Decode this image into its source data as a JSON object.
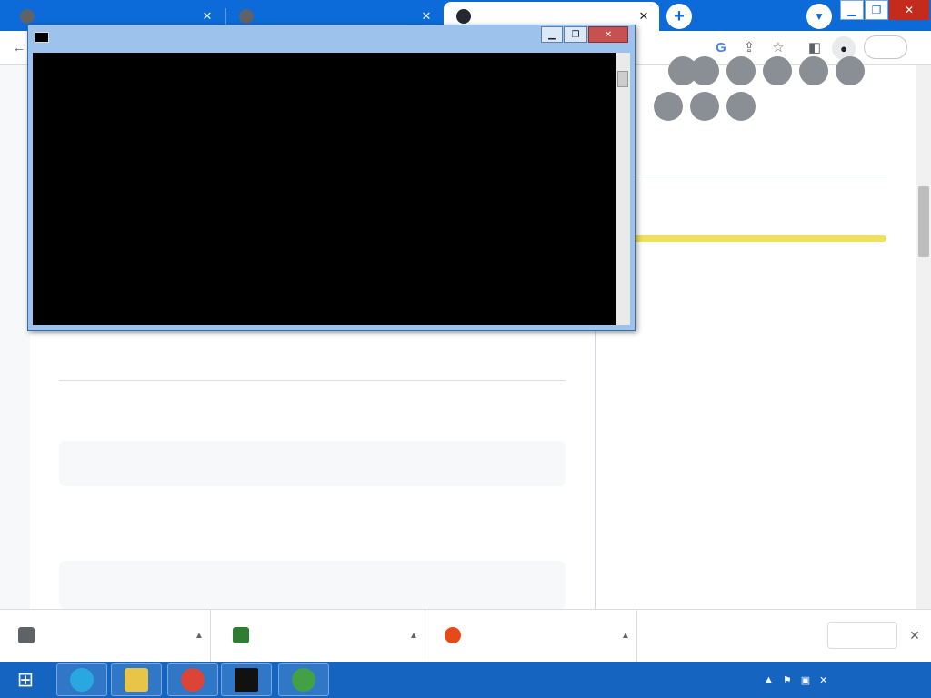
{
  "browser": {
    "tabs": [
      {},
      {},
      {}
    ]
  },
  "colors": {
    "titlebar": "#0c6bd8",
    "cmd_frame": "#9dc3ec",
    "console_bg": "#000000",
    "taskbar": "#1565c0",
    "language_bar": "#f1e05a"
  },
  "downloads": {
    "items": [
      {},
      {},
      {}
    ]
  },
  "icons": [
    "close-icon",
    "plus-icon",
    "chevron-down-icon",
    "back-arrow-icon",
    "google-icon",
    "share-icon",
    "star-icon",
    "sidebar-icon",
    "profile-icon",
    "minimize-icon",
    "maximize-icon",
    "windows-logo-icon",
    "ie-icon",
    "folder-icon",
    "chrome-icon",
    "terminal-icon",
    "idm-icon",
    "flag-icon",
    "network-icon",
    "volume-muted-icon"
  ]
}
